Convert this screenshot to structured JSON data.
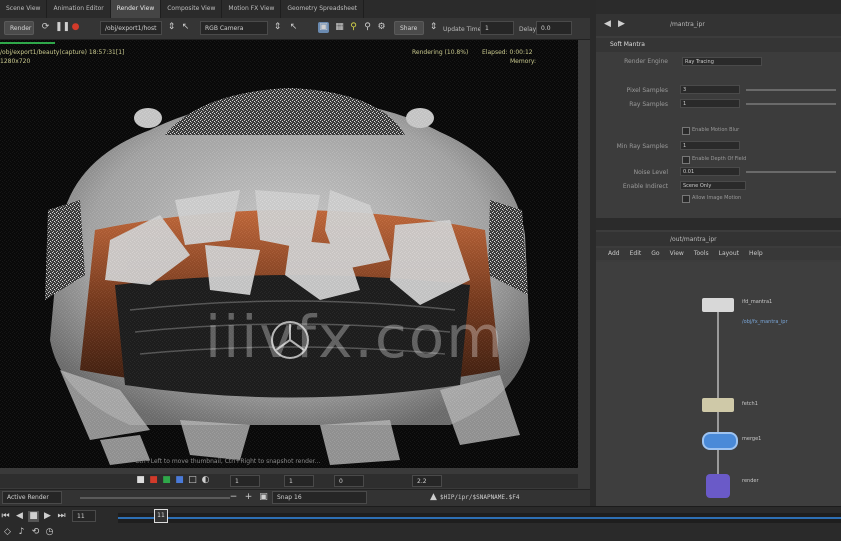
{
  "tabs": [
    "Scene View",
    "Animation Editor",
    "Render View",
    "Composite View",
    "Motion FX View",
    "Geometry Spreadsheet"
  ],
  "toolbar": {
    "render_label": "Render",
    "camera_path": "/obj/export1/host",
    "colorspace": "RGB Camera",
    "share_label": "Share",
    "update_time_label": "Update Time",
    "update_time_value": "1",
    "delay_label": "Delay",
    "delay_value": "0.0"
  },
  "viewport": {
    "path_text": "/obj/export1/beauty(capture) 18:57:31[1]",
    "res_text": "1280x720",
    "rendering_text": "Rendering (10.8%)",
    "elapsed_text": "Elapsed: 0:00:12",
    "memory_text": "Memory:",
    "hint_text": "Ctrl+Left to move thumbnail, Ctrl+Right to snapshot render...",
    "watermark": "iiivfx.com"
  },
  "viewbar": {
    "frame_value": "1",
    "sample_value": "1",
    "exposure_value": "0",
    "gamma_value": "2.2"
  },
  "renderbar": {
    "active_render": "Active Render",
    "snap_label": "Snap 16",
    "path_text": "$HIP/ipr/$SNAPNAME.$F4"
  },
  "timeline": {
    "current_frame": "11",
    "frame_marker": "11"
  },
  "rightpanel": {
    "path_label": "/mantra_ipr",
    "node_type": "Soft Mantra",
    "params": [
      {
        "label": "Render Engine",
        "value": "Ray Tracing"
      },
      {
        "label": "Pixel Samples",
        "value": "3"
      },
      {
        "label": "Ray Samples",
        "value": "1"
      },
      {
        "label": "Min Ray Samples",
        "value": "1"
      },
      {
        "label": "Noise Level",
        "value": "0.01"
      },
      {
        "label": "Enable Indirect",
        "value": "Scene Only"
      }
    ],
    "checkbox_labels": [
      "Enable Motion Blur",
      "Enable Depth Of Field",
      "Allow Image Motion"
    ],
    "network_path": "/out/mantra_ipr",
    "network_menu": [
      "Add",
      "Edit",
      "Go",
      "View",
      "Tools",
      "Layout",
      "Help"
    ],
    "nodes": [
      {
        "name": "ifd_mantra1",
        "sub": "/obj/fx_mantra_ipr"
      },
      {
        "name": "fetch1",
        "sub": ""
      },
      {
        "name": "merge1",
        "sub": ""
      },
      {
        "name": "render",
        "sub": ""
      }
    ]
  },
  "colors": {
    "render_red": "#d23a2a",
    "node_blue": "#4a8ad8",
    "progress_green": "#2fa84a",
    "timeline_blue": "#2d6fb4"
  }
}
